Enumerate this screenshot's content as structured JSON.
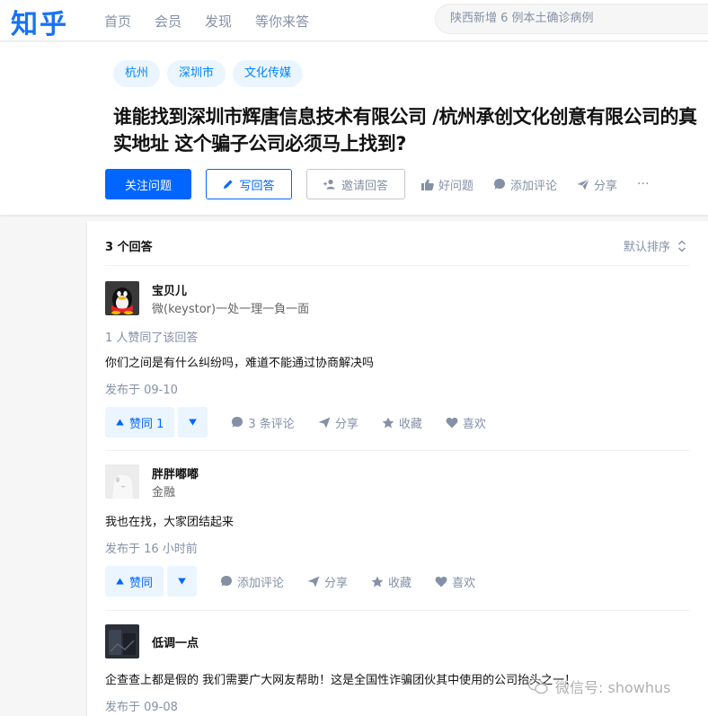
{
  "header": {
    "logo": "知乎",
    "nav": [
      "首页",
      "会员",
      "发现",
      "等你来答"
    ],
    "search_placeholder": "陕西新增 6 例本土确诊病例"
  },
  "question": {
    "tags": [
      "杭州",
      "深圳市",
      "文化传媒"
    ],
    "title": "谁能找到深圳市辉唐信息技术有限公司 /杭州承创文化创意有限公司的真实地址 这个骗子公司必须马上找到?",
    "follow_label": "关注问题",
    "write_label": "写回答",
    "invite_label": "邀请回答",
    "good_label": "好问题",
    "comment_label": "添加评论",
    "share_label": "分享",
    "more_label": "···"
  },
  "answers_header": {
    "count": "3 个回答",
    "sort_label": "默认排序"
  },
  "answers": [
    {
      "name": "宝贝儿",
      "bio": "微(keystor)一处一理一負一面",
      "vote_info": "1 人赞同了该回答",
      "content": "你们之间是有什么纠纷吗，难道不能通过协商解决吗",
      "date": "发布于 09-10",
      "vote_label": "赞同 1",
      "comment_label": "3 条评论",
      "share_label": "分享",
      "collect_label": "收藏",
      "like_label": "喜欢"
    },
    {
      "name": "胖胖嘟嘟",
      "bio": "金融",
      "content": "我也在找，大家团结起来",
      "date": "发布于 16 小时前",
      "vote_label": "赞同",
      "comment_label": "添加评论",
      "share_label": "分享",
      "collect_label": "收藏",
      "like_label": "喜欢"
    },
    {
      "name": "低调一点",
      "content": "企查查上都是假的 我们需要广大网友帮助！这是全国性诈骗团伙其中使用的公司抬头之一！",
      "date": "发布于 09-08"
    }
  ],
  "watermark": "微信号: showhus",
  "colors": {
    "brand": "#0066ff",
    "logo": "#1772f6",
    "muted": "#8590a6",
    "tag_bg": "#ebf5ff"
  }
}
